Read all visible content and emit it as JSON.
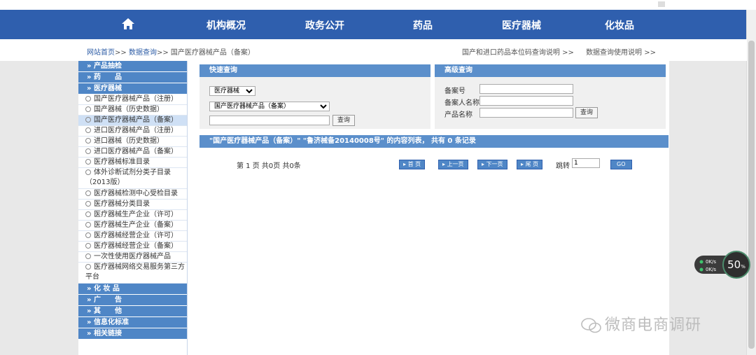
{
  "nav": {
    "items": [
      "机构概况",
      "政务公开",
      "药品",
      "医疗器械",
      "化妆品"
    ]
  },
  "breadcrumb": {
    "home": "网站首页",
    "sep1": ">>",
    "query": "数据查询",
    "sep2": ">>",
    "current": "国产医疗器械产品（备案）"
  },
  "rightlinks": [
    "国产和进口药品本位码查询说明 >>",
    "数据查询使用说明 >>"
  ],
  "sidebar": {
    "cat_choujian": "» 产品抽检",
    "cat_yaopin": "» 药　　品",
    "cat_qixie": "» 医疗器械",
    "items": [
      "国产医疗器械产品（注册）",
      "国产器械（历史数据）",
      "国产医疗器械产品（备案）",
      "进口医疗器械产品（注册）",
      "进口器械（历史数据）",
      "进口医疗器械产品（备案）",
      "医疗器械标准目录",
      "体外诊断试剂分类子目录（2013版）",
      "医疗器械检测中心受检目录",
      "医疗器械分类目录",
      "医疗器械生产企业（许可）",
      "医疗器械生产企业（备案）",
      "医疗器械经营企业（许可）",
      "医疗器械经营企业（备案）",
      "一次性使用医疗器械产品",
      "医疗器械网络交易服务第三方平台"
    ],
    "cat_huazhuangpin": "» 化 妆 品",
    "cat_guanggao": "» 广　　告",
    "cat_qita": "» 其　　他",
    "cat_xinxihua": "» 信息化标准",
    "cat_lianjie": "» 相关链接"
  },
  "quick": {
    "title": "快速查询",
    "select1": "医疗器械",
    "select2": "国产医疗器械产品（备案）",
    "input": "",
    "button": "查询"
  },
  "advanced": {
    "title": "高级查询",
    "label1": "备案号",
    "label2": "备案人名称",
    "label3": "产品名称",
    "button": "查询"
  },
  "results": {
    "header": "\"国产医疗器械产品（备案）\" \"鲁济械备20140008号\" 的内容列表， 共有 0 条记录",
    "pager_text": "第 1 页 共0页 共0条",
    "first": "首 页",
    "prev": "上一页",
    "next": "下一页",
    "last": "尾 页",
    "jump_label": "跳转",
    "jump_value": "1",
    "go": "GO"
  },
  "widget": {
    "percent": "50",
    "up": "0K/s",
    "down": "0K/s"
  },
  "watermark": "微商电商调研"
}
